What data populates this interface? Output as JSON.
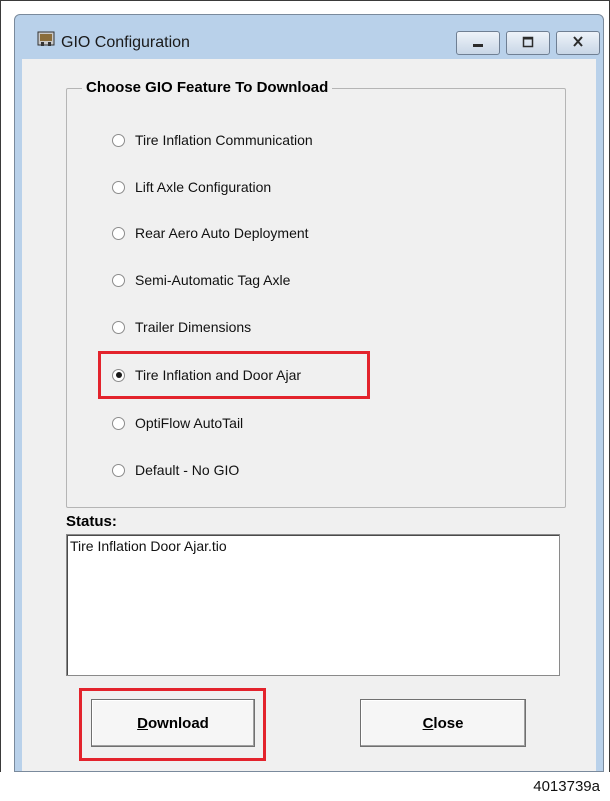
{
  "window": {
    "title": "GIO Configuration",
    "controls": [
      "minimize",
      "maximize",
      "close"
    ]
  },
  "group": {
    "legend": "Choose GIO Feature To Download",
    "options": [
      {
        "label": "Tire Inflation Communication",
        "checked": false
      },
      {
        "label": "Lift Axle Configuration",
        "checked": false
      },
      {
        "label": "Rear Aero Auto Deployment",
        "checked": false
      },
      {
        "label": "Semi-Automatic Tag Axle",
        "checked": false
      },
      {
        "label": "Trailer Dimensions",
        "checked": false
      },
      {
        "label": "Tire Inflation and Door Ajar",
        "checked": true
      },
      {
        "label": "OptiFlow AutoTail",
        "checked": false
      },
      {
        "label": "Default - No GIO",
        "checked": false
      }
    ]
  },
  "status": {
    "label": "Status:",
    "value": "Tire Inflation Door Ajar.tio"
  },
  "buttons": {
    "download_first": "D",
    "download_rest": "ownload",
    "close_first": "C",
    "close_rest": "lose"
  },
  "figure_id": "4013739a",
  "colors": {
    "highlight": "#e3232c",
    "frame": "#b9d1ea",
    "client": "#f0f0f0"
  }
}
